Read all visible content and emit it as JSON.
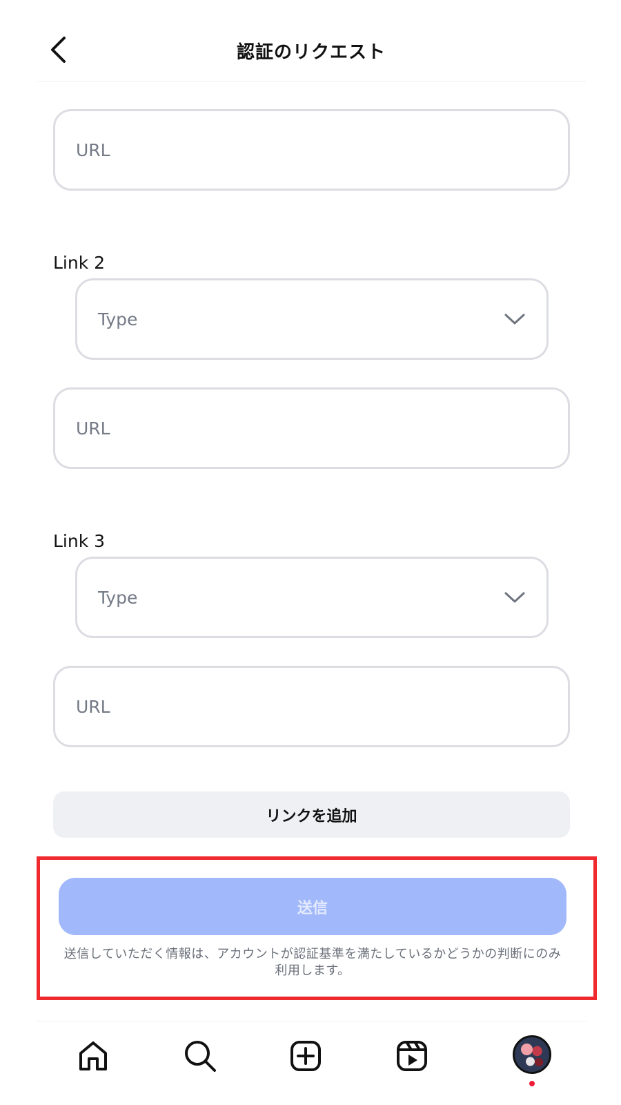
{
  "header": {
    "title": "認証のリクエスト"
  },
  "form": {
    "link1": {
      "url_placeholder": "URL"
    },
    "link2": {
      "label": "Link 2",
      "type_placeholder": "Type",
      "url_placeholder": "URL"
    },
    "link3": {
      "label": "Link 3",
      "type_placeholder": "Type",
      "url_placeholder": "URL"
    },
    "add_link_label": "リンクを追加",
    "submit_label": "送信",
    "disclaimer_line1": "送信していただく情報は、アカウントが認証基準を満たしているかどうかの判断にのみ",
    "disclaimer_line2": "利用します。"
  },
  "nav": {
    "items": [
      {
        "icon": "home-icon"
      },
      {
        "icon": "search-icon"
      },
      {
        "icon": "create-icon"
      },
      {
        "icon": "reels-icon"
      },
      {
        "icon": "profile-avatar"
      }
    ]
  },
  "colors": {
    "highlight": "#ee2a2f",
    "submit_disabled": "#a1b8fa",
    "notification": "#ee1d36"
  }
}
